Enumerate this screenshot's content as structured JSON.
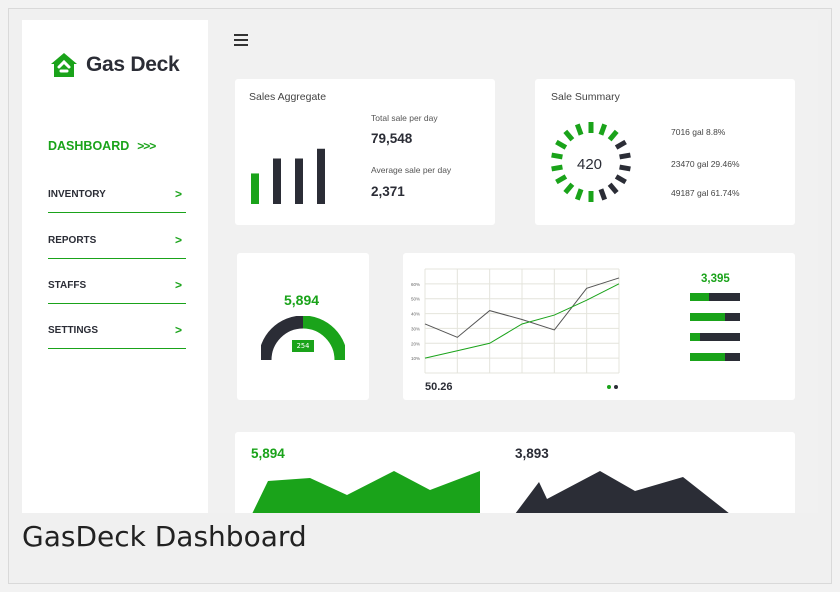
{
  "brand": {
    "name": "Gas Deck"
  },
  "sidebar": {
    "active": {
      "label": "DASHBOARD",
      "indicator": ">>>"
    },
    "items": [
      {
        "label": "INVENTORY",
        "chevron": ">"
      },
      {
        "label": "REPORTS",
        "chevron": ">"
      },
      {
        "label": "STAFFS",
        "chevron": ">"
      },
      {
        "label": "SETTINGS",
        "chevron": ">"
      }
    ]
  },
  "sales_aggregate": {
    "title": "Sales Aggregate",
    "total_label": "Total sale per day",
    "total_value": "79,548",
    "avg_label": "Average sale per day",
    "avg_value": "2,371",
    "bars": [
      {
        "value": 0.47,
        "color": "#1aa31a"
      },
      {
        "value": 0.7,
        "color": "#2b2d36"
      },
      {
        "value": 0.7,
        "color": "#2b2d36"
      },
      {
        "value": 0.85,
        "color": "#2b2d36"
      }
    ]
  },
  "sale_summary": {
    "title": "Sale Summary",
    "center_value": "420",
    "rows": [
      "7016 gal 8.8%",
      "23470 gal 29.46%",
      "49187 gal 61.74%"
    ]
  },
  "gauge": {
    "value": "5,894",
    "badge": "254",
    "fraction": 0.5
  },
  "line_chart": {
    "reading": "50.26",
    "y_ticks": [
      "60%",
      "50%",
      "40%",
      "30%",
      "20%",
      "10%"
    ],
    "series": [
      {
        "color": "#555555",
        "values": [
          33,
          24,
          42,
          36,
          29,
          57,
          64
        ]
      },
      {
        "color": "#1aa31a",
        "values": [
          10,
          15,
          20,
          33,
          39,
          49,
          60
        ]
      }
    ],
    "hbar_value": "3,395",
    "hbars": [
      0.38,
      0.7,
      0.2,
      0.7
    ]
  },
  "area_left": {
    "value": "5,894"
  },
  "area_right": {
    "value": "3,893"
  },
  "caption": "GasDeck Dashboard",
  "colors": {
    "green": "#1aa31a",
    "dark": "#2b2d36"
  }
}
